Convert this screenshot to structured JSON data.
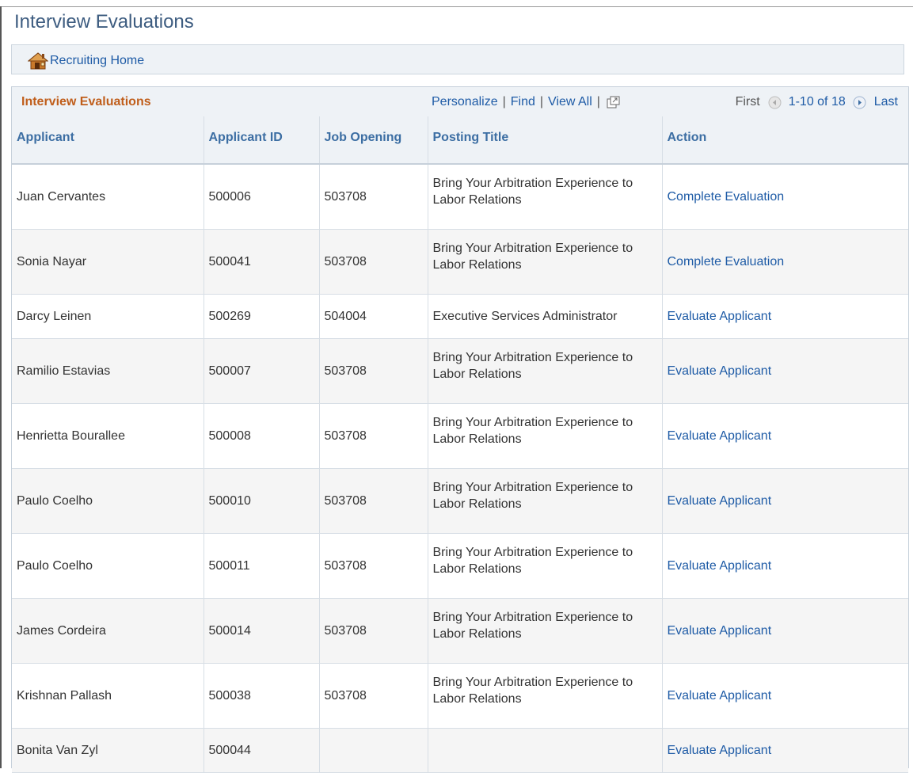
{
  "page": {
    "title": "Interview Evaluations"
  },
  "nav": {
    "home_label": "Recruiting Home"
  },
  "grid": {
    "title": "Interview Evaluations",
    "tools": {
      "personalize": "Personalize",
      "find": "Find",
      "view_all": "View All"
    },
    "pager": {
      "first": "First",
      "range": "1-10 of 18",
      "last": "Last"
    },
    "columns": [
      "Applicant",
      "Applicant ID",
      "Job Opening",
      "Posting Title",
      "Action"
    ],
    "rows": [
      {
        "applicant": "Juan Cervantes",
        "applicant_id": "500006",
        "job_opening": "503708",
        "posting_title": "Bring Your Arbitration Experience to Labor Relations",
        "action": "Complete Evaluation"
      },
      {
        "applicant": "Sonia Nayar",
        "applicant_id": "500041",
        "job_opening": "503708",
        "posting_title": "Bring Your Arbitration Experience to Labor Relations",
        "action": "Complete Evaluation"
      },
      {
        "applicant": "Darcy Leinen",
        "applicant_id": "500269",
        "job_opening": "504004",
        "posting_title": "Executive Services Administrator",
        "action": "Evaluate Applicant"
      },
      {
        "applicant": "Ramilio Estavias",
        "applicant_id": "500007",
        "job_opening": "503708",
        "posting_title": "Bring Your Arbitration Experience to Labor Relations",
        "action": "Evaluate Applicant"
      },
      {
        "applicant": "Henrietta Bourallee",
        "applicant_id": "500008",
        "job_opening": "503708",
        "posting_title": "Bring Your Arbitration Experience to Labor Relations",
        "action": "Evaluate Applicant"
      },
      {
        "applicant": "Paulo Coelho",
        "applicant_id": "500010",
        "job_opening": "503708",
        "posting_title": "Bring Your Arbitration Experience to Labor Relations",
        "action": "Evaluate Applicant"
      },
      {
        "applicant": "Paulo Coelho",
        "applicant_id": "500011",
        "job_opening": "503708",
        "posting_title": "Bring Your Arbitration Experience to Labor Relations",
        "action": "Evaluate Applicant"
      },
      {
        "applicant": "James Cordeira",
        "applicant_id": "500014",
        "job_opening": "503708",
        "posting_title": "Bring Your Arbitration Experience to Labor Relations",
        "action": "Evaluate Applicant"
      },
      {
        "applicant": "Krishnan Pallash",
        "applicant_id": "500038",
        "job_opening": "503708",
        "posting_title": "Bring Your Arbitration Experience to Labor Relations",
        "action": "Evaluate Applicant"
      },
      {
        "applicant": "Bonita Van Zyl",
        "applicant_id": "500044",
        "job_opening": "",
        "posting_title": "",
        "action": "Evaluate Applicant"
      }
    ]
  },
  "colors": {
    "title": "#3d5c80",
    "link": "#1e5ba6",
    "grid_title": "#c05e1b",
    "header_bg": "#eef2f6",
    "alt_row": "#f5f5f5"
  },
  "icons": {
    "home": "home-icon",
    "popout": "popout-icon",
    "prev": "prev-page-icon",
    "next": "next-page-icon"
  }
}
